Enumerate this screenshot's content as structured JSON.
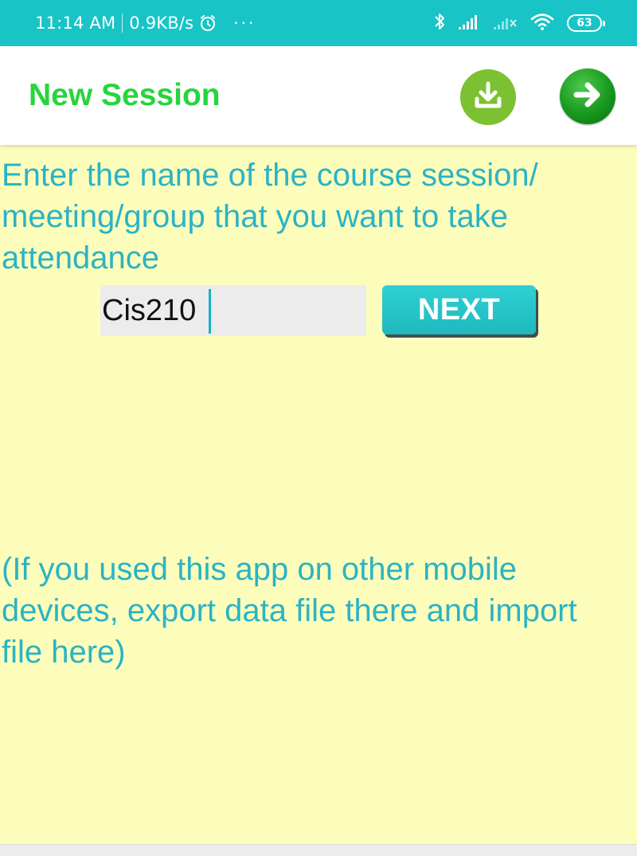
{
  "status_bar": {
    "time": "11:14 AM",
    "network_speed": "0.9KB/s",
    "battery": "63",
    "icons": [
      "alarm-icon",
      "more-dots-icon",
      "bluetooth-icon",
      "signal-icon",
      "signal-no-service-icon",
      "wifi-icon",
      "battery-icon"
    ],
    "color": "#18c4c5"
  },
  "app_bar": {
    "title": "New Session",
    "title_color": "#27d43d",
    "actions": [
      {
        "icon": "import-download-icon",
        "color": "#7cc131"
      },
      {
        "icon": "arrow-right-icon",
        "color": "#17991e"
      }
    ]
  },
  "main": {
    "prompt": "Enter the name of the course session/ meeting/group that you want to take attendance",
    "session_name_value": "Cis210",
    "next_label": "NEXT",
    "hint": "(If you used this app on other mobile devices, export data file there and import file here)",
    "text_color": "#2bb3c5",
    "background": "#fdfdbb"
  }
}
